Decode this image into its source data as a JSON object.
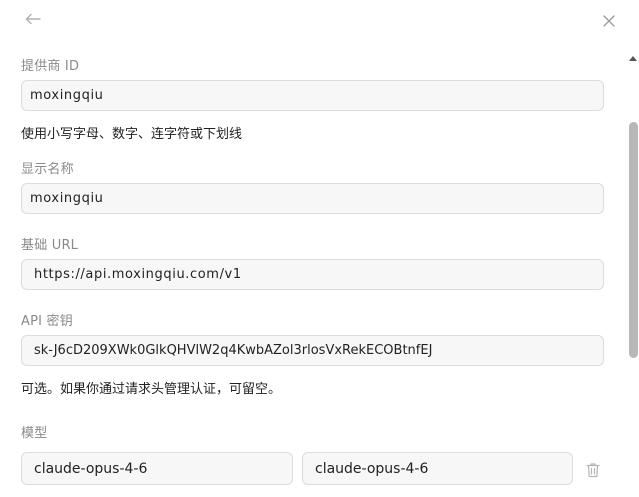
{
  "provider_id": {
    "label": "提供商 ID",
    "value": "moxingqiu",
    "hint": "使用小写字母、数字、连字符或下划线"
  },
  "display_name": {
    "label": "显示名称",
    "value": "moxingqiu"
  },
  "base_url": {
    "label": "基础 URL",
    "value": "https://api.moxingqiu.com/v1"
  },
  "api_key": {
    "label": "API 密钥",
    "value": "sk-J6cD209XWk0GlkQHVlW2q4KwbAZol3rlosVxRekECOBtnfEJ",
    "hint": "可选。如果你通过请求头管理认证，可留空。"
  },
  "models": {
    "label": "模型",
    "rows": [
      {
        "model_id": "claude-opus-4-6",
        "display_name": "claude-opus-4-6"
      }
    ]
  },
  "icons": {
    "back": "arrow-left-icon",
    "close": "close-icon",
    "delete": "trash-icon"
  }
}
